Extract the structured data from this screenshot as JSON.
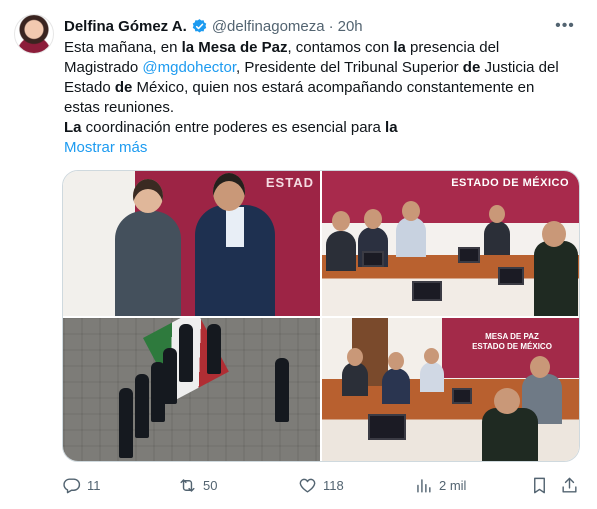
{
  "author": {
    "display_name": "Delfina Gómez A.",
    "handle": "@delfinagomeza",
    "separator": "·",
    "time": "20h",
    "verified_color": "#1d9bf0"
  },
  "tweet": {
    "line1": {
      "a": "Esta mañana, en ",
      "b": "la Mesa de Paz",
      "c": ", contamos con ",
      "d": "la",
      "e": " presencia del"
    },
    "line2": {
      "a": "Magistrado ",
      "mention": "@mgdohector",
      "b": ", Presidente del Tribunal Superior ",
      "c": "de",
      "d": " Justicia del"
    },
    "line3": {
      "a": "Estado ",
      "b": "de",
      "c": " México, quien nos estará acompañando constantemente en"
    },
    "line4": {
      "a": "estas reuniones."
    },
    "line5": {
      "a": "La",
      "b": " coordinación entre poderes es esencial para ",
      "c": "la"
    },
    "show_more": "Mostrar más"
  },
  "media": {
    "photo1_sign": "ESTAD",
    "photo2_sign": "ESTADO DE MÉXICO",
    "photo4_banner_line1": "MESA DE PAZ",
    "photo4_banner_line2": "ESTADO DE MÉXICO"
  },
  "actions": {
    "replies": "11",
    "reposts": "50",
    "likes": "118",
    "views": "2 mil"
  },
  "colors": {
    "link": "#1d9bf0",
    "muted": "#536471",
    "text": "#0f1419",
    "brand_maroon": "#9d2445"
  },
  "icons": [
    "verified-badge-icon",
    "more-icon",
    "reply-icon",
    "repost-icon",
    "like-icon",
    "views-icon",
    "bookmark-icon",
    "share-icon"
  ]
}
